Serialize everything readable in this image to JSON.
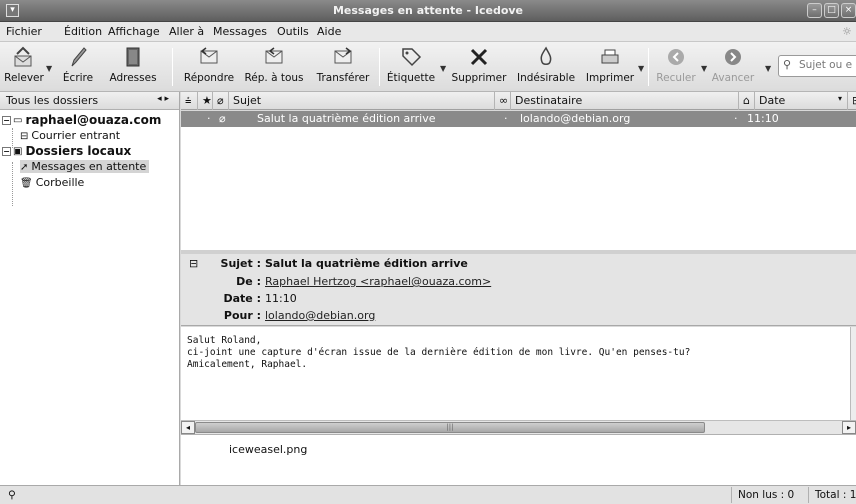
{
  "window": {
    "title": "Messages en attente - Icedove",
    "icon": "app-icon",
    "controls": [
      "minimize-icon",
      "maximize-icon",
      "close-icon"
    ]
  },
  "menubar": {
    "items": [
      "Fichier",
      "Édition",
      "Affichage",
      "Aller à",
      "Messages",
      "Outils",
      "Aide"
    ]
  },
  "toolbar": {
    "releve": "Relever",
    "ecrire": "Écrire",
    "adresses": "Adresses",
    "repondre": "Répondre",
    "rep_tous": "Rép. à tous",
    "transferer": "Transférer",
    "etiquette": "Étiquette",
    "supprimer": "Supprimer",
    "indesirable": "Indésirable",
    "imprimer": "Imprimer",
    "reculer": "Reculer",
    "avancer": "Avancer",
    "search_placeholder": "Sujet ou e"
  },
  "folders": {
    "header": "Tous les dossiers",
    "items": [
      {
        "label": "raphael@ouaza.com",
        "level": 0,
        "bold": true
      },
      {
        "label": "Courrier entrant",
        "level": 1,
        "bold": false
      },
      {
        "label": "Dossiers locaux",
        "level": 0,
        "bold": true
      },
      {
        "label": "Messages en attente",
        "level": 1,
        "bold": false,
        "selected": true
      },
      {
        "label": "Corbeille",
        "level": 1,
        "bold": false
      }
    ]
  },
  "message_list": {
    "columns": {
      "subject": "Sujet",
      "recipient": "Destinataire",
      "date": "Date"
    },
    "rows": [
      {
        "subject": "Salut la quatrième édition arrive",
        "recipient": "lolando@debian.org",
        "date": "11:10"
      }
    ]
  },
  "headers": {
    "subject_label": "Sujet :",
    "subject": "Salut la quatrième édition arrive",
    "from_label": "De :",
    "from": "Raphael Hertzog <raphael@ouaza.com>",
    "date_label": "Date :",
    "date": "11:10",
    "to_label": "Pour :",
    "to": "lolando@debian.org"
  },
  "body": {
    "lines": [
      "Salut Roland,",
      "ci-joint une capture d'écran issue de la dernière édition de mon livre. Qu'en penses-tu?",
      "",
      "Amicalement, Raphael."
    ]
  },
  "attachment": {
    "name": "iceweasel.png"
  },
  "status": {
    "unread": "Non lus : 0",
    "total": "Total : 1"
  }
}
